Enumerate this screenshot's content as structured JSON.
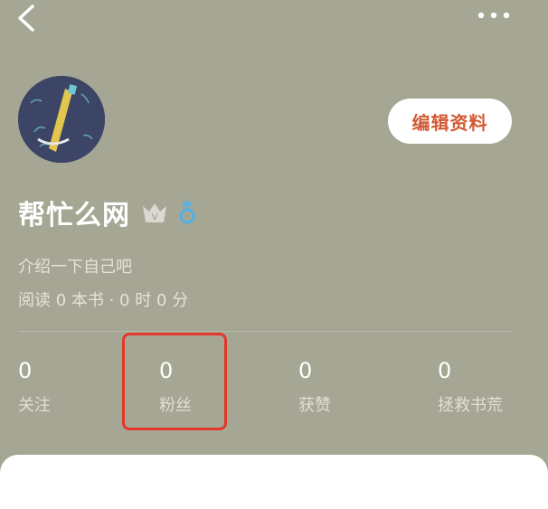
{
  "header": {
    "back_icon": "chevron-left-icon",
    "more_icon": "more-horizontal-icon"
  },
  "profile": {
    "edit_label": "编辑资料",
    "name": "帮忙么网",
    "badge_icon": "crown-v-icon",
    "gender_icon": "male-gender-icon",
    "bio": "介绍一下自己吧",
    "reading_stats": "阅读 0 本书 · 0 时 0 分"
  },
  "stats": [
    {
      "value": "0",
      "label": "关注"
    },
    {
      "value": "0",
      "label": "粉丝"
    },
    {
      "value": "0",
      "label": "获赞"
    },
    {
      "value": "0",
      "label": "拯救书荒"
    }
  ],
  "colors": {
    "background": "#a6a694",
    "accent": "#d35a34",
    "highlight_box": "#e4372a",
    "gender_blue": "#4fb3e8"
  }
}
